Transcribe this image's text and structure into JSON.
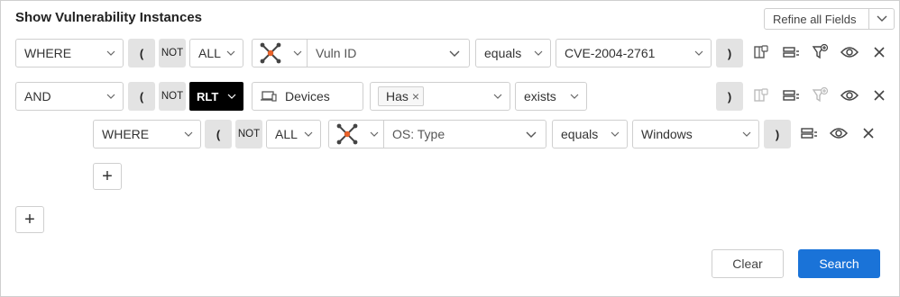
{
  "title": "Show Vulnerability Instances",
  "refine_label": "Refine all Fields",
  "rows": [
    {
      "conjunction": "WHERE",
      "open_paren": "(",
      "not_label": "NOT",
      "quantifier": "ALL",
      "field": "Vuln ID",
      "operator": "equals",
      "value": "CVE-2004-2761",
      "close_paren": ")"
    },
    {
      "conjunction": "AND",
      "open_paren": "(",
      "not_label": "NOT",
      "quantifier": "RLT",
      "entity": "Devices",
      "relation_tag": "Has",
      "operator": "exists",
      "close_paren": ")"
    },
    {
      "conjunction": "WHERE",
      "open_paren": "(",
      "not_label": "NOT",
      "quantifier": "ALL",
      "field": "OS: Type",
      "operator": "equals",
      "value": "Windows",
      "close_paren": ")"
    }
  ],
  "add_symbol": "+",
  "tag_remove_symbol": "×",
  "buttons": {
    "clear": "Clear",
    "search": "Search"
  },
  "colors": {
    "primary": "#1a73d8",
    "rlt_bg": "#000000",
    "icon_orange": "#e8622a",
    "icon_gray": "#444444"
  },
  "icons": [
    "chevron-down-icon",
    "nodes-icon",
    "devices-icon",
    "eye-icon",
    "close-icon",
    "filter-add-icon",
    "list-icon",
    "table-icon"
  ]
}
